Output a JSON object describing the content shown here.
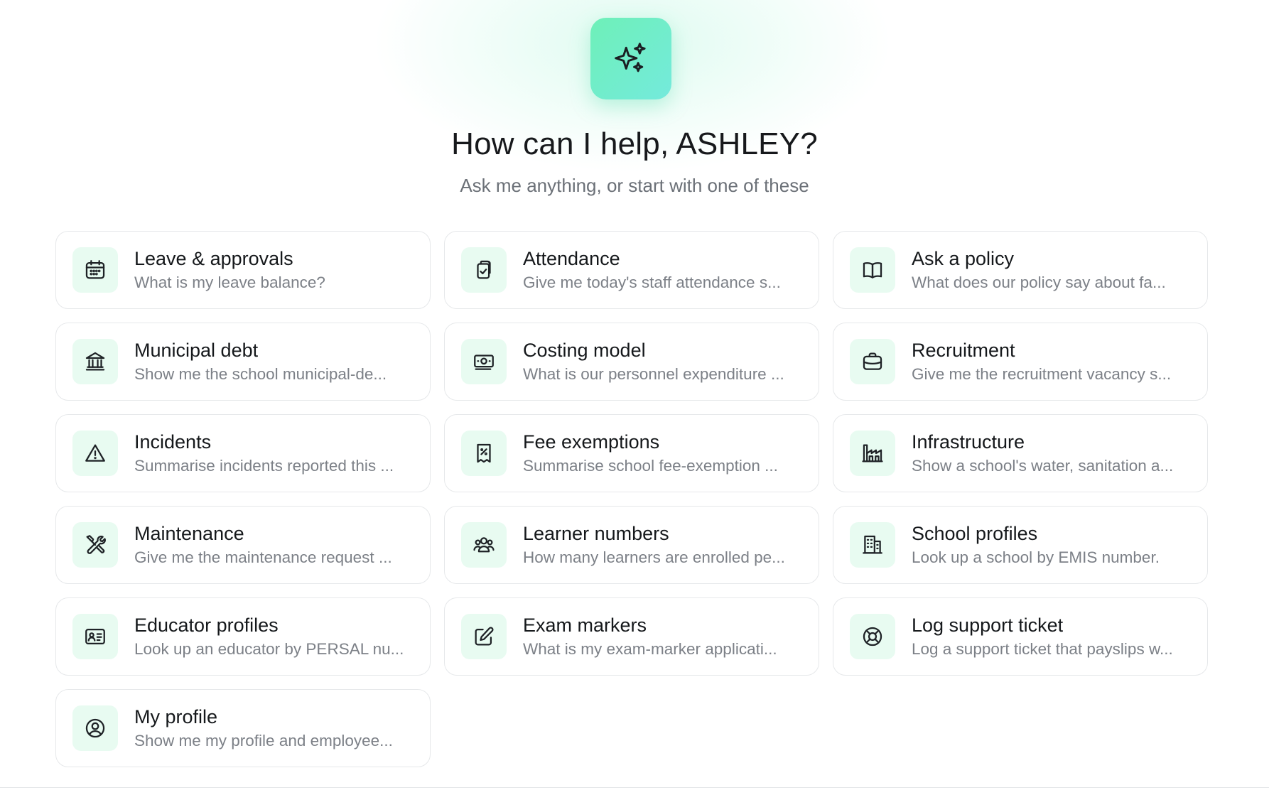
{
  "header": {
    "title": "How can I help, ASHLEY?",
    "subtitle": "Ask me anything, or start with one of these"
  },
  "colors": {
    "accent": "#6ef0b8",
    "icon_tile_bg": "#e8fbf1",
    "card_border": "#e6e8ea"
  },
  "cards": [
    {
      "title": "Leave & approvals",
      "subtitle": "What is my leave balance?",
      "icon": "calendar-icon"
    },
    {
      "title": "Attendance",
      "subtitle": "Give me today's staff attendance s...",
      "icon": "clipboard-check-icon"
    },
    {
      "title": "Ask a policy",
      "subtitle": "What does our policy say about fa...",
      "icon": "book-icon"
    },
    {
      "title": "Municipal debt",
      "subtitle": "Show me the school municipal-de...",
      "icon": "bank-icon"
    },
    {
      "title": "Costing model",
      "subtitle": "What is our personnel expenditure ...",
      "icon": "money-icon"
    },
    {
      "title": "Recruitment",
      "subtitle": "Give me the recruitment vacancy s...",
      "icon": "briefcase-icon"
    },
    {
      "title": "Incidents",
      "subtitle": "Summarise incidents reported this ...",
      "icon": "warning-icon"
    },
    {
      "title": "Fee exemptions",
      "subtitle": "Summarise school fee-exemption ...",
      "icon": "receipt-percent-icon"
    },
    {
      "title": "Infrastructure",
      "subtitle": "Show a school's water, sanitation a...",
      "icon": "factory-icon"
    },
    {
      "title": "Maintenance",
      "subtitle": "Give me the maintenance request ...",
      "icon": "tools-icon"
    },
    {
      "title": "Learner numbers",
      "subtitle": "How many learners are enrolled pe...",
      "icon": "users-icon"
    },
    {
      "title": "School profiles",
      "subtitle": "Look up a school by EMIS number.",
      "icon": "building-icon"
    },
    {
      "title": "Educator profiles",
      "subtitle": "Look up an educator by PERSAL nu...",
      "icon": "id-card-icon"
    },
    {
      "title": "Exam markers",
      "subtitle": "What is my exam-marker applicati...",
      "icon": "pencil-square-icon"
    },
    {
      "title": "Log support ticket",
      "subtitle": "Log a support ticket that payslips w...",
      "icon": "lifebuoy-icon"
    },
    {
      "title": "My profile",
      "subtitle": "Show me my profile and employee...",
      "icon": "user-circle-icon"
    }
  ]
}
